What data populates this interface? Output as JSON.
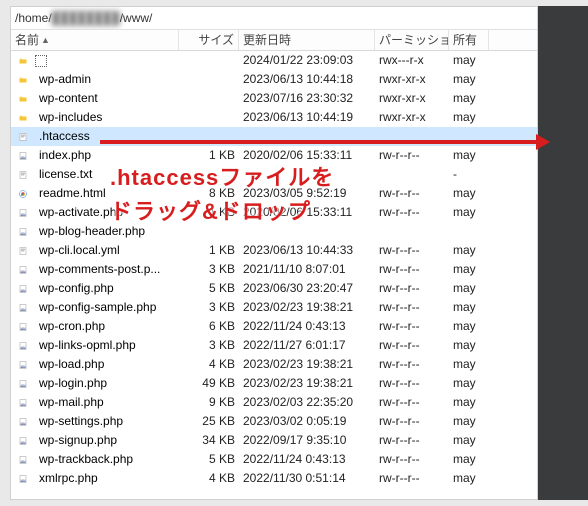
{
  "breadcrumb": {
    "prefix": "/home/",
    "blurred": "████████",
    "suffix": "/www/"
  },
  "columns": {
    "name": "名前",
    "size": "サイズ",
    "date": "更新日時",
    "perm": "パーミッション",
    "owner": "所有"
  },
  "overlay": {
    "line1": ".htaccessファイルを",
    "line2": "ドラッグ&ドロップ"
  },
  "owner_value": "may",
  "files": [
    {
      "icon": "up",
      "name": "..",
      "size": "",
      "date": "2024/01/22 23:09:03",
      "perm": "rwx---r-x",
      "owner": "may",
      "sel": false
    },
    {
      "icon": "folder",
      "name": "wp-admin",
      "size": "",
      "date": "2023/06/13 10:44:18",
      "perm": "rwxr-xr-x",
      "owner": "may",
      "sel": false
    },
    {
      "icon": "folder",
      "name": "wp-content",
      "size": "",
      "date": "2023/07/16 23:30:32",
      "perm": "rwxr-xr-x",
      "owner": "may",
      "sel": false
    },
    {
      "icon": "folder",
      "name": "wp-includes",
      "size": "",
      "date": "2023/06/13 10:44:19",
      "perm": "rwxr-xr-x",
      "owner": "may",
      "sel": false
    },
    {
      "icon": "txt",
      "name": ".htaccess",
      "size": "",
      "date": "",
      "perm": "",
      "owner": "",
      "sel": true
    },
    {
      "icon": "php",
      "name": "index.php",
      "size": "1 KB",
      "date": "2020/02/06 15:33:11",
      "perm": "rw-r--r--",
      "owner": "may",
      "sel": false
    },
    {
      "icon": "txt",
      "name": "license.txt",
      "size": "",
      "date": "",
      "perm": "",
      "owner": "-",
      "sel": false
    },
    {
      "icon": "html",
      "name": "readme.html",
      "size": "8 KB",
      "date": "2023/03/05 9:52:19",
      "perm": "rw-r--r--",
      "owner": "may",
      "sel": false
    },
    {
      "icon": "php",
      "name": "wp-activate.php",
      "size": "1 KB",
      "date": "2020/02/06 15:33:11",
      "perm": "rw-r--r--",
      "owner": "may",
      "sel": false
    },
    {
      "icon": "php",
      "name": "wp-blog-header.php",
      "size": "",
      "date": "",
      "perm": "",
      "owner": "",
      "sel": false
    },
    {
      "icon": "txt",
      "name": "wp-cli.local.yml",
      "size": "1 KB",
      "date": "2023/06/13 10:44:33",
      "perm": "rw-r--r--",
      "owner": "may",
      "sel": false
    },
    {
      "icon": "php",
      "name": "wp-comments-post.p...",
      "size": "3 KB",
      "date": "2021/11/10 8:07:01",
      "perm": "rw-r--r--",
      "owner": "may",
      "sel": false
    },
    {
      "icon": "php",
      "name": "wp-config.php",
      "size": "5 KB",
      "date": "2023/06/30 23:20:47",
      "perm": "rw-r--r--",
      "owner": "may",
      "sel": false
    },
    {
      "icon": "php",
      "name": "wp-config-sample.php",
      "size": "3 KB",
      "date": "2023/02/23 19:38:21",
      "perm": "rw-r--r--",
      "owner": "may",
      "sel": false
    },
    {
      "icon": "php",
      "name": "wp-cron.php",
      "size": "6 KB",
      "date": "2022/11/24 0:43:13",
      "perm": "rw-r--r--",
      "owner": "may",
      "sel": false
    },
    {
      "icon": "php",
      "name": "wp-links-opml.php",
      "size": "3 KB",
      "date": "2022/11/27 6:01:17",
      "perm": "rw-r--r--",
      "owner": "may",
      "sel": false
    },
    {
      "icon": "php",
      "name": "wp-load.php",
      "size": "4 KB",
      "date": "2023/02/23 19:38:21",
      "perm": "rw-r--r--",
      "owner": "may",
      "sel": false
    },
    {
      "icon": "php",
      "name": "wp-login.php",
      "size": "49 KB",
      "date": "2023/02/23 19:38:21",
      "perm": "rw-r--r--",
      "owner": "may",
      "sel": false
    },
    {
      "icon": "php",
      "name": "wp-mail.php",
      "size": "9 KB",
      "date": "2023/02/03 22:35:20",
      "perm": "rw-r--r--",
      "owner": "may",
      "sel": false
    },
    {
      "icon": "php",
      "name": "wp-settings.php",
      "size": "25 KB",
      "date": "2023/03/02 0:05:19",
      "perm": "rw-r--r--",
      "owner": "may",
      "sel": false
    },
    {
      "icon": "php",
      "name": "wp-signup.php",
      "size": "34 KB",
      "date": "2022/09/17 9:35:10",
      "perm": "rw-r--r--",
      "owner": "may",
      "sel": false
    },
    {
      "icon": "php",
      "name": "wp-trackback.php",
      "size": "5 KB",
      "date": "2022/11/24 0:43:13",
      "perm": "rw-r--r--",
      "owner": "may",
      "sel": false
    },
    {
      "icon": "php",
      "name": "xmlrpc.php",
      "size": "4 KB",
      "date": "2022/11/30 0:51:14",
      "perm": "rw-r--r--",
      "owner": "may",
      "sel": false
    }
  ]
}
